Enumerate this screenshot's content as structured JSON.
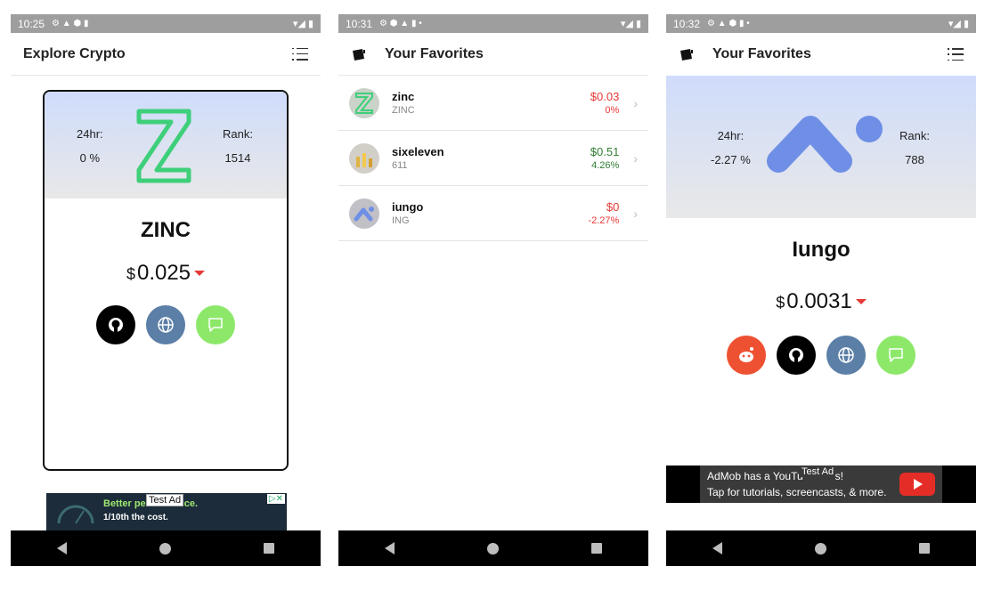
{
  "screens": [
    {
      "status_time": "10:25",
      "title": "Explore Crypto",
      "coin": {
        "name": "ZINC",
        "stat_24hr_label": "24hr:",
        "stat_24hr_value": "0 %",
        "rank_label": "Rank:",
        "rank_value": "1514",
        "currency_symbol": "$",
        "price": "0.025",
        "trend": "down"
      },
      "ad": {
        "line1": "Better pe",
        "line1_end": "ice.",
        "line2": "1/10th the cost.",
        "tag": "Test Ad"
      }
    },
    {
      "status_time": "10:31",
      "title": "Your Favorites",
      "favorites": [
        {
          "name": "zinc",
          "symbol": "ZINC",
          "price": "$0.03",
          "change": "0%",
          "trend": "red"
        },
        {
          "name": "sixeleven",
          "symbol": "611",
          "price": "$0.51",
          "change": "4.26%",
          "trend": "green"
        },
        {
          "name": "iungo",
          "symbol": "ING",
          "price": "$0",
          "change": "-2.27%",
          "trend": "red"
        }
      ]
    },
    {
      "status_time": "10:32",
      "title": "Your Favorites",
      "coin": {
        "name": "Iungo",
        "stat_24hr_label": "24hr:",
        "stat_24hr_value": "-2.27 %",
        "rank_label": "Rank:",
        "rank_value": "788",
        "currency_symbol": "$",
        "price": "0.0031",
        "trend": "down"
      },
      "ad": {
        "line1": "AdMob has a YouTu",
        "line1_end": "s!",
        "line2": "Tap for tutorials, screencasts, & more.",
        "tag": "Test Ad"
      }
    }
  ],
  "icons": {
    "github": "github-icon",
    "website": "globe-icon",
    "chat": "chat-icon",
    "reddit": "reddit-icon",
    "menu": "list-menu-icon",
    "wallet": "wallet-icon"
  },
  "colors": {
    "accent_red": "#e53935",
    "accent_green": "#2e7d32",
    "github_bg": "#000000",
    "web_bg": "#5b7fa6",
    "chat_bg": "#8de86a",
    "reddit_bg": "#ee5132"
  }
}
